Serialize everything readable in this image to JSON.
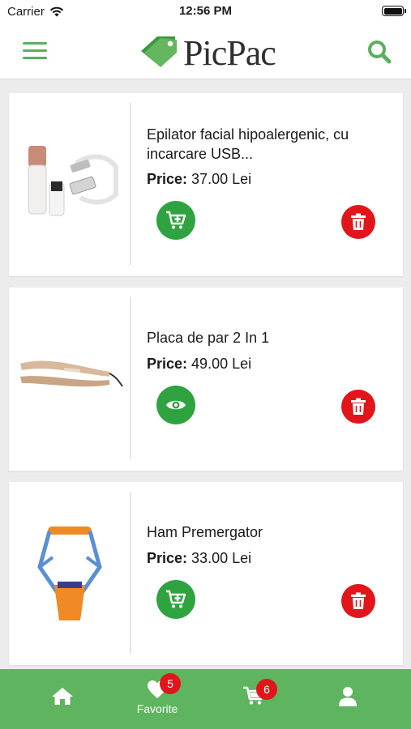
{
  "status_bar": {
    "carrier": "Carrier",
    "time": "12:56 PM"
  },
  "header": {
    "logo_text": "PicPac",
    "menu_icon": "hamburger-icon",
    "search_icon": "search-icon"
  },
  "products": [
    {
      "title": "Epilator facial hipoalergenic, cu incarcare USB...",
      "price_label": "Price:",
      "price": "37.00 Lei",
      "action": "add-to-cart"
    },
    {
      "title": "Placa de par 2 In 1",
      "price_label": "Price:",
      "price": "49.00 Lei",
      "action": "view"
    },
    {
      "title": "Ham Premergator",
      "price_label": "Price:",
      "price": "33.00 Lei",
      "action": "add-to-cart"
    }
  ],
  "tabbar": {
    "favorites_label": "Favorite",
    "favorites_count": "5",
    "cart_count": "6"
  },
  "colors": {
    "brand_green": "#5fb45f",
    "action_green": "#2fa33f",
    "delete_red": "#e2151b"
  }
}
